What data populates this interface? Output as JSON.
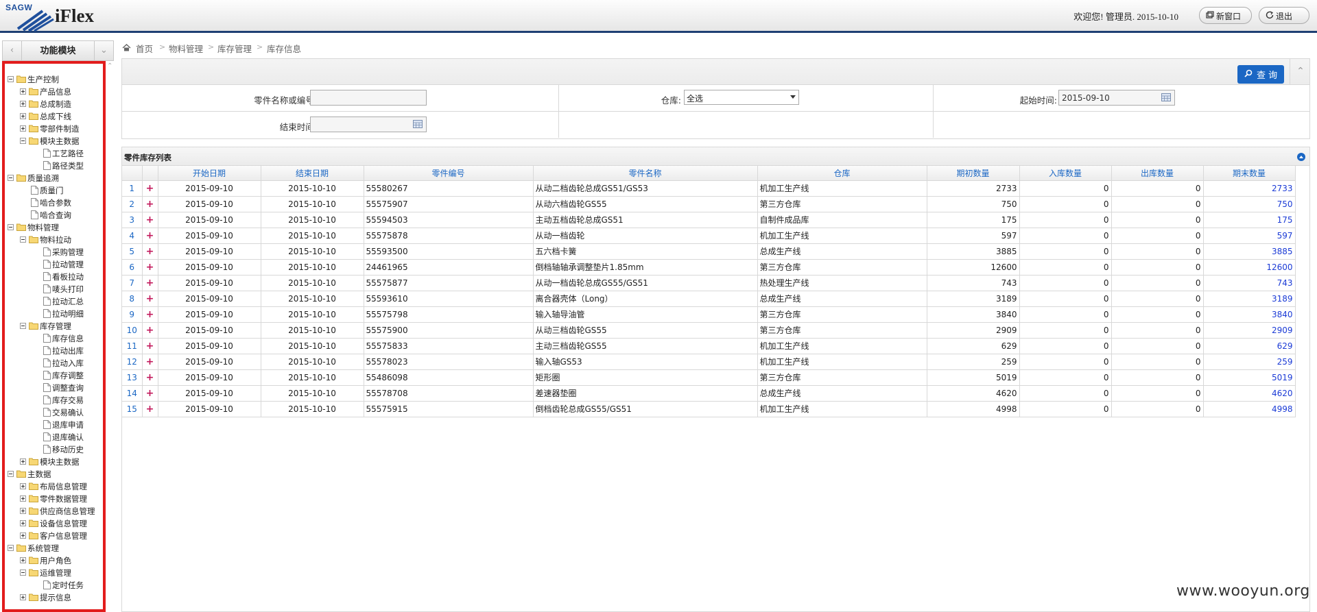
{
  "header": {
    "brand": "SAGW",
    "product": "iFlex",
    "welcome": "欢迎您! 管理员. 2015-10-10",
    "new_window": "新窗口",
    "logout": "退出"
  },
  "sidebar": {
    "title": "功能模块",
    "tree": [
      {
        "label": "生产控制",
        "toggle": "minus",
        "icon": "folder",
        "level": 0
      },
      {
        "label": "产品信息",
        "toggle": "plus",
        "icon": "folder",
        "level": 1
      },
      {
        "label": "总成制造",
        "toggle": "plus",
        "icon": "folder",
        "level": 1
      },
      {
        "label": "总成下线",
        "toggle": "plus",
        "icon": "folder",
        "level": 1
      },
      {
        "label": "零部件制造",
        "toggle": "plus",
        "icon": "folder",
        "level": 1
      },
      {
        "label": "模块主数据",
        "toggle": "minus",
        "icon": "folder",
        "level": 1
      },
      {
        "label": "工艺路径",
        "toggle": "",
        "icon": "page",
        "level": 2
      },
      {
        "label": "路径类型",
        "toggle": "",
        "icon": "page",
        "level": 2
      },
      {
        "label": "质量追溯",
        "toggle": "minus",
        "icon": "folder",
        "level": 0
      },
      {
        "label": "质量门",
        "toggle": "",
        "icon": "page",
        "level": 1
      },
      {
        "label": "啮合参数",
        "toggle": "",
        "icon": "page",
        "level": 1
      },
      {
        "label": "啮合查询",
        "toggle": "",
        "icon": "page",
        "level": 1
      },
      {
        "label": "物料管理",
        "toggle": "minus",
        "icon": "folder",
        "level": 0
      },
      {
        "label": "物料拉动",
        "toggle": "minus",
        "icon": "folder",
        "level": 1
      },
      {
        "label": "采购管理",
        "toggle": "",
        "icon": "page",
        "level": 2
      },
      {
        "label": "拉动管理",
        "toggle": "",
        "icon": "page",
        "level": 2
      },
      {
        "label": "看板拉动",
        "toggle": "",
        "icon": "page",
        "level": 2
      },
      {
        "label": "唛头打印",
        "toggle": "",
        "icon": "page",
        "level": 2
      },
      {
        "label": "拉动汇总",
        "toggle": "",
        "icon": "page",
        "level": 2
      },
      {
        "label": "拉动明细",
        "toggle": "",
        "icon": "page",
        "level": 2
      },
      {
        "label": "库存管理",
        "toggle": "minus",
        "icon": "folder",
        "level": 1
      },
      {
        "label": "库存信息",
        "toggle": "",
        "icon": "page",
        "level": 2
      },
      {
        "label": "拉动出库",
        "toggle": "",
        "icon": "page",
        "level": 2
      },
      {
        "label": "拉动入库",
        "toggle": "",
        "icon": "page",
        "level": 2
      },
      {
        "label": "库存调整",
        "toggle": "",
        "icon": "page",
        "level": 2
      },
      {
        "label": "调整查询",
        "toggle": "",
        "icon": "page",
        "level": 2
      },
      {
        "label": "库存交易",
        "toggle": "",
        "icon": "page",
        "level": 2
      },
      {
        "label": "交易确认",
        "toggle": "",
        "icon": "page",
        "level": 2
      },
      {
        "label": "退库申请",
        "toggle": "",
        "icon": "page",
        "level": 2
      },
      {
        "label": "退库确认",
        "toggle": "",
        "icon": "page",
        "level": 2
      },
      {
        "label": "移动历史",
        "toggle": "",
        "icon": "page",
        "level": 2
      },
      {
        "label": "模块主数据",
        "toggle": "plus",
        "icon": "folder",
        "level": 1
      },
      {
        "label": "主数据",
        "toggle": "minus",
        "icon": "folder",
        "level": 0
      },
      {
        "label": "布局信息管理",
        "toggle": "plus",
        "icon": "folder",
        "level": 1
      },
      {
        "label": "零件数据管理",
        "toggle": "plus",
        "icon": "folder",
        "level": 1
      },
      {
        "label": "供应商信息管理",
        "toggle": "plus",
        "icon": "folder",
        "level": 1
      },
      {
        "label": "设备信息管理",
        "toggle": "plus",
        "icon": "folder",
        "level": 1
      },
      {
        "label": "客户信息管理",
        "toggle": "plus",
        "icon": "folder",
        "level": 1
      },
      {
        "label": "系统管理",
        "toggle": "minus",
        "icon": "folder",
        "level": 0
      },
      {
        "label": "用户角色",
        "toggle": "plus",
        "icon": "folder",
        "level": 1
      },
      {
        "label": "运维管理",
        "toggle": "minus",
        "icon": "folder",
        "level": 1
      },
      {
        "label": "定时任务",
        "toggle": "",
        "icon": "page",
        "level": 2
      },
      {
        "label": "提示信息",
        "toggle": "plus",
        "icon": "folder",
        "level": 1
      }
    ]
  },
  "breadcrumb": [
    "首页",
    "物料管理",
    "库存管理",
    "库存信息"
  ],
  "search": {
    "query_button": "查 询",
    "part_label": "零件名称或编号:",
    "part_value": "",
    "warehouse_label": "仓库:",
    "warehouse_value": "全选",
    "start_label": "起始时间:",
    "start_value": "2015-09-10",
    "end_label": "结束时间:",
    "end_value": ""
  },
  "grid": {
    "title": "零件库存列表",
    "columns": [
      "开始日期",
      "结束日期",
      "零件编号",
      "零件名称",
      "仓库",
      "期初数量",
      "入库数量",
      "出库数量",
      "期末数量"
    ],
    "rows": [
      [
        "1",
        "2015-09-10",
        "2015-10-10",
        "55580267",
        "从动二档齿轮总成GS51/GS53",
        "机加工生产线",
        "2733",
        "0",
        "0",
        "2733"
      ],
      [
        "2",
        "2015-09-10",
        "2015-10-10",
        "55575907",
        "从动六档齿轮GS55",
        "第三方仓库",
        "750",
        "0",
        "0",
        "750"
      ],
      [
        "3",
        "2015-09-10",
        "2015-10-10",
        "55594503",
        "主动五档齿轮总成GS51",
        "自制件成品库",
        "175",
        "0",
        "0",
        "175"
      ],
      [
        "4",
        "2015-09-10",
        "2015-10-10",
        "55575878",
        "从动一档齿轮",
        "机加工生产线",
        "597",
        "0",
        "0",
        "597"
      ],
      [
        "5",
        "2015-09-10",
        "2015-10-10",
        "55593500",
        "五六档卡簧",
        "总成生产线",
        "3885",
        "0",
        "0",
        "3885"
      ],
      [
        "6",
        "2015-09-10",
        "2015-10-10",
        "24461965",
        "倒档轴轴承调整垫片1.85mm",
        "第三方仓库",
        "12600",
        "0",
        "0",
        "12600"
      ],
      [
        "7",
        "2015-09-10",
        "2015-10-10",
        "55575877",
        "从动一档齿轮总成GS55/GS51",
        "热处理生产线",
        "743",
        "0",
        "0",
        "743"
      ],
      [
        "8",
        "2015-09-10",
        "2015-10-10",
        "55593610",
        "离合器壳体（Long）",
        "总成生产线",
        "3189",
        "0",
        "0",
        "3189"
      ],
      [
        "9",
        "2015-09-10",
        "2015-10-10",
        "55575798",
        "输入轴导油管",
        "第三方仓库",
        "3840",
        "0",
        "0",
        "3840"
      ],
      [
        "10",
        "2015-09-10",
        "2015-10-10",
        "55575900",
        "从动三档齿轮GS55",
        "第三方仓库",
        "2909",
        "0",
        "0",
        "2909"
      ],
      [
        "11",
        "2015-09-10",
        "2015-10-10",
        "55575833",
        "主动三档齿轮GS55",
        "机加工生产线",
        "629",
        "0",
        "0",
        "629"
      ],
      [
        "12",
        "2015-09-10",
        "2015-10-10",
        "55578023",
        "输入轴GS53",
        "机加工生产线",
        "259",
        "0",
        "0",
        "259"
      ],
      [
        "13",
        "2015-09-10",
        "2015-10-10",
        "55486098",
        "矩形圈",
        "第三方仓库",
        "5019",
        "0",
        "0",
        "5019"
      ],
      [
        "14",
        "2015-09-10",
        "2015-10-10",
        "55578708",
        "差速器垫圈",
        "总成生产线",
        "4620",
        "0",
        "0",
        "4620"
      ],
      [
        "15",
        "2015-09-10",
        "2015-10-10",
        "55575915",
        "倒档齿轮总成GS55/GS51",
        "机加工生产线",
        "4998",
        "0",
        "0",
        "4998"
      ]
    ]
  },
  "watermark": "www.wooyun.org",
  "colors": {
    "accent": "#1b67c4",
    "header_bar": "#1e3f73",
    "highlight_frame": "#e21c1c",
    "plus_mark": "#c2185b"
  }
}
